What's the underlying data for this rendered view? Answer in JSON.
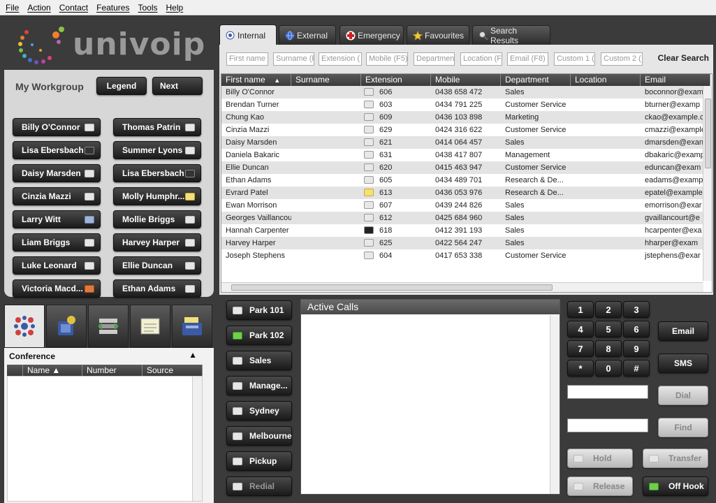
{
  "menu": [
    "File",
    "Action",
    "Contact",
    "Features",
    "Tools",
    "Help"
  ],
  "logo": {
    "word": "univoip"
  },
  "workgroup": {
    "title": "My Workgroup",
    "legend_label": "Legend",
    "next_label": "Next",
    "members": [
      {
        "name": "Billy O'Connor",
        "status": "idle"
      },
      {
        "name": "Thomas Patrin",
        "status": "idle"
      },
      {
        "name": "Lisa Ebersbach",
        "status": "dark"
      },
      {
        "name": "Summer Lyons",
        "status": "idle"
      },
      {
        "name": "Daisy Marsden",
        "status": "idle"
      },
      {
        "name": "Lisa Ebersbach",
        "status": "dark"
      },
      {
        "name": "Cinzia Mazzi",
        "status": "idle"
      },
      {
        "name": "Molly Humphr...",
        "status": "yellow"
      },
      {
        "name": "Larry Witt",
        "status": "phone"
      },
      {
        "name": "Mollie Briggs",
        "status": "idle"
      },
      {
        "name": "Liam Briggs",
        "status": "idle"
      },
      {
        "name": "Harvey Harper",
        "status": "idle"
      },
      {
        "name": "Luke Leonard",
        "status": "idle"
      },
      {
        "name": "Ellie Duncan",
        "status": "idle"
      },
      {
        "name": "Victoria Macd...",
        "status": "orange"
      },
      {
        "name": "Ethan Adams",
        "status": "idle"
      }
    ]
  },
  "tabs": [
    {
      "label": "Internal",
      "icon": "radio-icon",
      "active": true
    },
    {
      "label": "External",
      "icon": "globe-icon",
      "active": false
    },
    {
      "label": "Emergency",
      "icon": "red-cross-icon",
      "active": false
    },
    {
      "label": "Favourites",
      "icon": "star-icon",
      "active": false
    },
    {
      "label": "Search Results",
      "icon": "magnifier-icon",
      "active": false
    }
  ],
  "search": {
    "fields": [
      "First name",
      "Surname (F",
      "Extension (",
      "Mobile (F5)",
      "Departmen",
      "Location (F",
      "Email (F8)",
      "Custom 1 (",
      "Custom 2 ("
    ],
    "clear_label": "Clear Search"
  },
  "directory": {
    "columns": [
      "First name",
      "Surname",
      "Extension",
      "Mobile",
      "Department",
      "Location",
      "Email"
    ],
    "rows": [
      {
        "name": "Billy O'Connor",
        "ext": "606",
        "mobile": "0438 658 472",
        "dept": "Sales",
        "email": "boconnor@exam",
        "ind": "idle"
      },
      {
        "name": "Brendan Turner",
        "ext": "603",
        "mobile": "0434 791 225",
        "dept": "Customer Service",
        "email": "bturner@examp",
        "ind": "idle"
      },
      {
        "name": "Chung Kao",
        "ext": "609",
        "mobile": "0436 103 898",
        "dept": "Marketing",
        "email": "ckao@example.c",
        "ind": "idle"
      },
      {
        "name": "Cinzia Mazzi",
        "ext": "629",
        "mobile": "0424 316 622",
        "dept": "Customer Service",
        "email": "cmazzi@example",
        "ind": "idle"
      },
      {
        "name": "Daisy Marsden",
        "ext": "621",
        "mobile": "0414 064 457",
        "dept": "Sales",
        "email": "dmarsden@exan",
        "ind": "idle"
      },
      {
        "name": "Daniela Bakaric",
        "ext": "631",
        "mobile": "0438 417 807",
        "dept": "Management",
        "email": "dbakaric@examp",
        "ind": "idle"
      },
      {
        "name": "Ellie Duncan",
        "ext": "620",
        "mobile": "0415 463 947",
        "dept": "Customer Service",
        "email": "eduncan@exam",
        "ind": "idle"
      },
      {
        "name": "Ethan Adams",
        "ext": "605",
        "mobile": "0434 489 701",
        "dept": "Research & De...",
        "email": "eadams@examp",
        "ind": "idle"
      },
      {
        "name": "Evrard Patel",
        "ext": "613",
        "mobile": "0436 053 976",
        "dept": "Research & De...",
        "email": "epatel@example",
        "ind": "yellow"
      },
      {
        "name": "Ewan Morrison",
        "ext": "607",
        "mobile": "0439 244 826",
        "dept": "Sales",
        "email": "emorrison@exar",
        "ind": "idle"
      },
      {
        "name": "Georges Vaillancourt",
        "ext": "612",
        "mobile": "0425 684 960",
        "dept": "Sales",
        "email": "gvaillancourt@e",
        "ind": "idle"
      },
      {
        "name": "Hannah Carpenter",
        "ext": "618",
        "mobile": "0412 391 193",
        "dept": "Sales",
        "email": "hcarpenter@exa",
        "ind": "dark"
      },
      {
        "name": "Harvey Harper",
        "ext": "625",
        "mobile": "0422 564 247",
        "dept": "Sales",
        "email": "hharper@exam",
        "ind": "idle"
      },
      {
        "name": "Joseph Stephens",
        "ext": "604",
        "mobile": "0417 653 338",
        "dept": "Customer Service",
        "email": "jstephens@exar",
        "ind": "idle"
      }
    ]
  },
  "bottom_tabs": [
    "conference-icon",
    "phone-book-icon",
    "transfer-icon",
    "memo-icon",
    "fax-icon"
  ],
  "conference": {
    "title": "Conference",
    "columns": [
      "Name",
      "Number",
      "Source"
    ]
  },
  "park_buttons": [
    {
      "label": "Park 101",
      "ind": "idle",
      "enabled": true
    },
    {
      "label": "Park 102",
      "ind": "green",
      "enabled": true
    },
    {
      "label": "Sales",
      "ind": "idle",
      "enabled": true
    },
    {
      "label": "Manage...",
      "ind": "idle",
      "enabled": true
    },
    {
      "label": "Sydney",
      "ind": "idle",
      "enabled": true
    },
    {
      "label": "Melbourne",
      "ind": "idle",
      "enabled": true
    },
    {
      "label": "Pickup",
      "ind": "idle",
      "enabled": true
    },
    {
      "label": "Redial",
      "ind": "idle",
      "enabled": false
    }
  ],
  "active_calls": {
    "title": "Active Calls"
  },
  "keypad": [
    "1",
    "2",
    "3",
    "4",
    "5",
    "6",
    "7",
    "8",
    "9",
    "*",
    "0",
    "#"
  ],
  "actions": {
    "email": "Email",
    "sms": "SMS",
    "dial": "Dial",
    "find": "Find",
    "hold": "Hold",
    "transfer": "Transfer",
    "release": "Release",
    "off_hook": "Off Hook"
  }
}
